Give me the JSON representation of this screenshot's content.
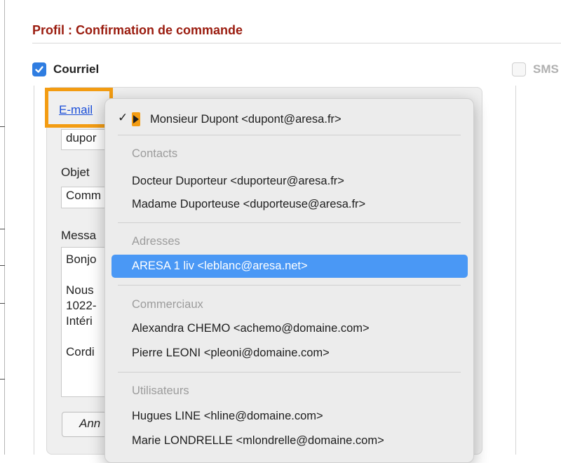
{
  "header": {
    "title": "Profil : Confirmation de commande"
  },
  "channels": {
    "courriel": {
      "label": "Courriel",
      "checked": true
    },
    "sms": {
      "label": "SMS",
      "checked": false
    }
  },
  "form": {
    "email_link": "E-mail",
    "email_value": "dupor",
    "objet_label": "Objet",
    "objet_value": "Comm",
    "message_label": "Messa",
    "message_lines": [
      "Bonjo",
      "",
      "Nous",
      "1022-",
      "Intéri",
      "",
      "Cordi"
    ],
    "cancel_label": "Ann"
  },
  "menu": {
    "current": "Monsieur Dupont <dupont@aresa.fr>",
    "sections": [
      {
        "header": "Contacts",
        "items": [
          "Docteur Duporteur <duporteur@aresa.fr>",
          "Madame Duporteuse <duporteuse@aresa.fr>"
        ]
      },
      {
        "header": "Adresses",
        "items": [
          "ARESA 1 liv <leblanc@aresa.net>"
        ]
      },
      {
        "header": "Commerciaux",
        "items": [
          "Alexandra CHEMO <achemo@domaine.com>",
          "Pierre LEONI <pleoni@domaine.com>"
        ]
      },
      {
        "header": "Utilisateurs",
        "items": [
          "Hugues LINE <hline@domaine.com>",
          "Marie LONDRELLE <mlondrelle@domaine.com>"
        ]
      }
    ],
    "highlighted": "ARESA 1 liv <leblanc@aresa.net>"
  },
  "colors": {
    "accent": "#2f7de1",
    "title": "#9a1b0e",
    "focus": "#f39c12",
    "selection": "#4a98f5"
  }
}
